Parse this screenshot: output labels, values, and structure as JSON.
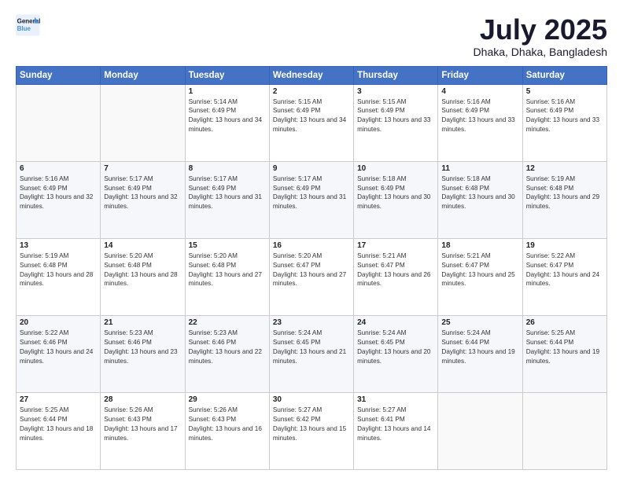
{
  "logo": {
    "line1": "General",
    "line2": "Blue"
  },
  "title": "July 2025",
  "subtitle": "Dhaka, Dhaka, Bangladesh",
  "days_header": [
    "Sunday",
    "Monday",
    "Tuesday",
    "Wednesday",
    "Thursday",
    "Friday",
    "Saturday"
  ],
  "weeks": [
    [
      {
        "day": "",
        "info": ""
      },
      {
        "day": "",
        "info": ""
      },
      {
        "day": "1",
        "info": "Sunrise: 5:14 AM\nSunset: 6:49 PM\nDaylight: 13 hours and 34 minutes."
      },
      {
        "day": "2",
        "info": "Sunrise: 5:15 AM\nSunset: 6:49 PM\nDaylight: 13 hours and 34 minutes."
      },
      {
        "day": "3",
        "info": "Sunrise: 5:15 AM\nSunset: 6:49 PM\nDaylight: 13 hours and 33 minutes."
      },
      {
        "day": "4",
        "info": "Sunrise: 5:16 AM\nSunset: 6:49 PM\nDaylight: 13 hours and 33 minutes."
      },
      {
        "day": "5",
        "info": "Sunrise: 5:16 AM\nSunset: 6:49 PM\nDaylight: 13 hours and 33 minutes."
      }
    ],
    [
      {
        "day": "6",
        "info": "Sunrise: 5:16 AM\nSunset: 6:49 PM\nDaylight: 13 hours and 32 minutes."
      },
      {
        "day": "7",
        "info": "Sunrise: 5:17 AM\nSunset: 6:49 PM\nDaylight: 13 hours and 32 minutes."
      },
      {
        "day": "8",
        "info": "Sunrise: 5:17 AM\nSunset: 6:49 PM\nDaylight: 13 hours and 31 minutes."
      },
      {
        "day": "9",
        "info": "Sunrise: 5:17 AM\nSunset: 6:49 PM\nDaylight: 13 hours and 31 minutes."
      },
      {
        "day": "10",
        "info": "Sunrise: 5:18 AM\nSunset: 6:49 PM\nDaylight: 13 hours and 30 minutes."
      },
      {
        "day": "11",
        "info": "Sunrise: 5:18 AM\nSunset: 6:48 PM\nDaylight: 13 hours and 30 minutes."
      },
      {
        "day": "12",
        "info": "Sunrise: 5:19 AM\nSunset: 6:48 PM\nDaylight: 13 hours and 29 minutes."
      }
    ],
    [
      {
        "day": "13",
        "info": "Sunrise: 5:19 AM\nSunset: 6:48 PM\nDaylight: 13 hours and 28 minutes."
      },
      {
        "day": "14",
        "info": "Sunrise: 5:20 AM\nSunset: 6:48 PM\nDaylight: 13 hours and 28 minutes."
      },
      {
        "day": "15",
        "info": "Sunrise: 5:20 AM\nSunset: 6:48 PM\nDaylight: 13 hours and 27 minutes."
      },
      {
        "day": "16",
        "info": "Sunrise: 5:20 AM\nSunset: 6:47 PM\nDaylight: 13 hours and 27 minutes."
      },
      {
        "day": "17",
        "info": "Sunrise: 5:21 AM\nSunset: 6:47 PM\nDaylight: 13 hours and 26 minutes."
      },
      {
        "day": "18",
        "info": "Sunrise: 5:21 AM\nSunset: 6:47 PM\nDaylight: 13 hours and 25 minutes."
      },
      {
        "day": "19",
        "info": "Sunrise: 5:22 AM\nSunset: 6:47 PM\nDaylight: 13 hours and 24 minutes."
      }
    ],
    [
      {
        "day": "20",
        "info": "Sunrise: 5:22 AM\nSunset: 6:46 PM\nDaylight: 13 hours and 24 minutes."
      },
      {
        "day": "21",
        "info": "Sunrise: 5:23 AM\nSunset: 6:46 PM\nDaylight: 13 hours and 23 minutes."
      },
      {
        "day": "22",
        "info": "Sunrise: 5:23 AM\nSunset: 6:46 PM\nDaylight: 13 hours and 22 minutes."
      },
      {
        "day": "23",
        "info": "Sunrise: 5:24 AM\nSunset: 6:45 PM\nDaylight: 13 hours and 21 minutes."
      },
      {
        "day": "24",
        "info": "Sunrise: 5:24 AM\nSunset: 6:45 PM\nDaylight: 13 hours and 20 minutes."
      },
      {
        "day": "25",
        "info": "Sunrise: 5:24 AM\nSunset: 6:44 PM\nDaylight: 13 hours and 19 minutes."
      },
      {
        "day": "26",
        "info": "Sunrise: 5:25 AM\nSunset: 6:44 PM\nDaylight: 13 hours and 19 minutes."
      }
    ],
    [
      {
        "day": "27",
        "info": "Sunrise: 5:25 AM\nSunset: 6:44 PM\nDaylight: 13 hours and 18 minutes."
      },
      {
        "day": "28",
        "info": "Sunrise: 5:26 AM\nSunset: 6:43 PM\nDaylight: 13 hours and 17 minutes."
      },
      {
        "day": "29",
        "info": "Sunrise: 5:26 AM\nSunset: 6:43 PM\nDaylight: 13 hours and 16 minutes."
      },
      {
        "day": "30",
        "info": "Sunrise: 5:27 AM\nSunset: 6:42 PM\nDaylight: 13 hours and 15 minutes."
      },
      {
        "day": "31",
        "info": "Sunrise: 5:27 AM\nSunset: 6:41 PM\nDaylight: 13 hours and 14 minutes."
      },
      {
        "day": "",
        "info": ""
      },
      {
        "day": "",
        "info": ""
      }
    ]
  ]
}
